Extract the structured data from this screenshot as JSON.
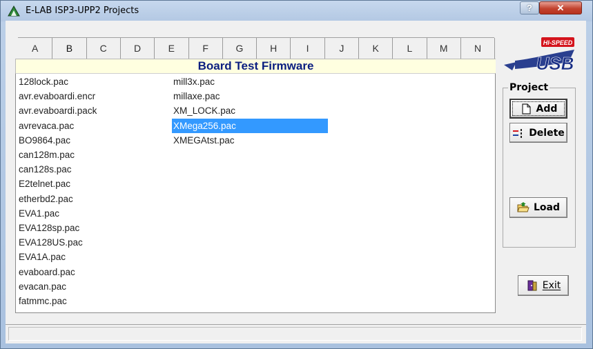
{
  "window": {
    "title": "E-LAB ISP3-UPP2 Projects",
    "help_glyph": "?",
    "close_glyph": "✕"
  },
  "tabs": [
    "A",
    "B",
    "C",
    "D",
    "E",
    "F",
    "G",
    "H",
    "I",
    "J",
    "K",
    "L",
    "M",
    "N"
  ],
  "active_tab": "B",
  "panel": {
    "title": "Board Test Firmware"
  },
  "files_col1": [
    "128lock.pac",
    "avr.evaboardi.encr",
    "avr.evaboardi.pack",
    "avrevaca.pac",
    "BO9864.pac",
    "can128m.pac",
    "can128s.pac",
    "E2telnet.pac",
    "etherbd2.pac",
    "EVA1.pac",
    "EVA128sp.pac",
    "EVA128US.pac",
    "EVA1A.pac",
    "evaboard.pac",
    "evacan.pac",
    "fatmmc.pac"
  ],
  "files_col2": [
    "mill3x.pac",
    "millaxe.pac",
    "XM_LOCK.pac",
    "XMega256.pac",
    "XMEGAtst.pac"
  ],
  "selected_file": "XMega256.pac",
  "logo": {
    "top_text": "HI-SPEED",
    "main_text": "USB"
  },
  "project": {
    "legend": "Project",
    "add_label": "Add",
    "delete_label": "Delete",
    "load_label": "Load"
  },
  "exit_label": "Exit",
  "status": {
    "text": ""
  },
  "colors": {
    "title_text": "#0b1e80",
    "selection": "#3399ff",
    "panel_title_bg": "#ffffe0"
  }
}
